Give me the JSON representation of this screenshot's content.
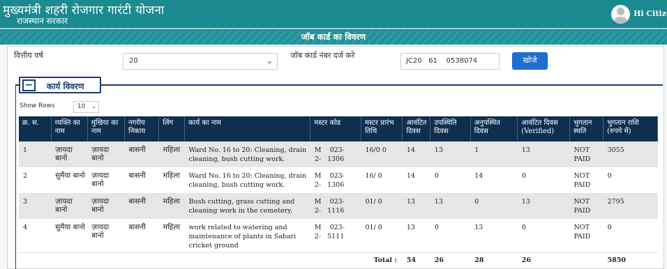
{
  "header": {
    "title": "मुख्यमंत्री शहरी रोजगार गारंटी योजना",
    "subtitle": "राजस्थान सरकार",
    "user_greeting": "Hi Citizen",
    "avatar_icon": "user-avatar-icon"
  },
  "page_title": "जॉब कार्ड का विवरण",
  "filters": {
    "year_label": "वित्तीय वर्ष",
    "year_value": "20",
    "job_card_label": "जॉब कार्ड नंबर दर्ज करे",
    "job_card_value": "JC20   61    0538074",
    "search_label": "खोजे"
  },
  "section": {
    "collapse_symbol": "−",
    "title": "कार्य विवरण"
  },
  "show_rows": {
    "label": "Show Rows",
    "value": "10"
  },
  "table": {
    "columns": [
      "क्र. स.",
      "व्यक्ति का नाम",
      "मुखिया का नाम",
      "नगरीय निकाय",
      "लिंग",
      "कार्य का नाम",
      "मस्टर कोड",
      "मस्टर प्रारंभ तिथि",
      "आवंटित दिवस",
      "उपस्थिति दिवस",
      "अनुपस्थित दिवस",
      "आवंटित दिवस (Verified)",
      "भुगतान स्थति",
      "भुगतान राशि (रुपये में)"
    ],
    "rows": [
      {
        "sno": "1",
        "person": "ज़ायदा बानो",
        "head": "ज़ायदा बानो",
        "body": "बासनी",
        "gender": "महिला",
        "work": "Ward No. 16 to 20: Cleaning, drain cleaning, bush cutting work.",
        "muster": "M    023-\n2-   1306",
        "start": "16/0   0",
        "allotted": "14",
        "present": "13",
        "absent": "1",
        "verified": "13",
        "status": "NOT PAID",
        "amount": "3055"
      },
      {
        "sno": "2",
        "person": "सुमैया बानो",
        "head": "ज़ायदा बानो",
        "body": "बासनी",
        "gender": "महिला",
        "work": "Ward No. 16 to 20: Cleaning, drain cleaning, bush cutting work.",
        "muster": "M    023-\n2-   1306",
        "start": "16/   0",
        "allotted": "14",
        "present": "0",
        "absent": "14",
        "verified": "0",
        "status": "NOT PAID",
        "amount": "0"
      },
      {
        "sno": "3",
        "person": "ज़ायदा बानो",
        "head": "ज़ायदा बानो",
        "body": "बासनी",
        "gender": "महिला",
        "work": "Bush cutting, grass cutting and cleaning work in the cemetery.",
        "muster": "M    023-\n2-   1116",
        "start": "01/   0",
        "allotted": "13",
        "present": "13",
        "absent": "0",
        "verified": "13",
        "status": "NOT PAID",
        "amount": "2795"
      },
      {
        "sno": "4",
        "person": "सुमैया बानो",
        "head": "ज़ायदा बानो",
        "body": "बासनी",
        "gender": "महिला",
        "work": "work related to watering and maintenance of plants in Sabari cricket ground",
        "muster": "M    023-\n2-   5111",
        "start": "01/   0",
        "allotted": "13",
        "present": "0",
        "absent": "13",
        "verified": "0",
        "status": "NOT PAID",
        "amount": "0"
      }
    ],
    "totals": {
      "label": "Total :",
      "allotted": "54",
      "present": "26",
      "absent": "28",
      "verified": "26",
      "amount": "5850"
    }
  }
}
